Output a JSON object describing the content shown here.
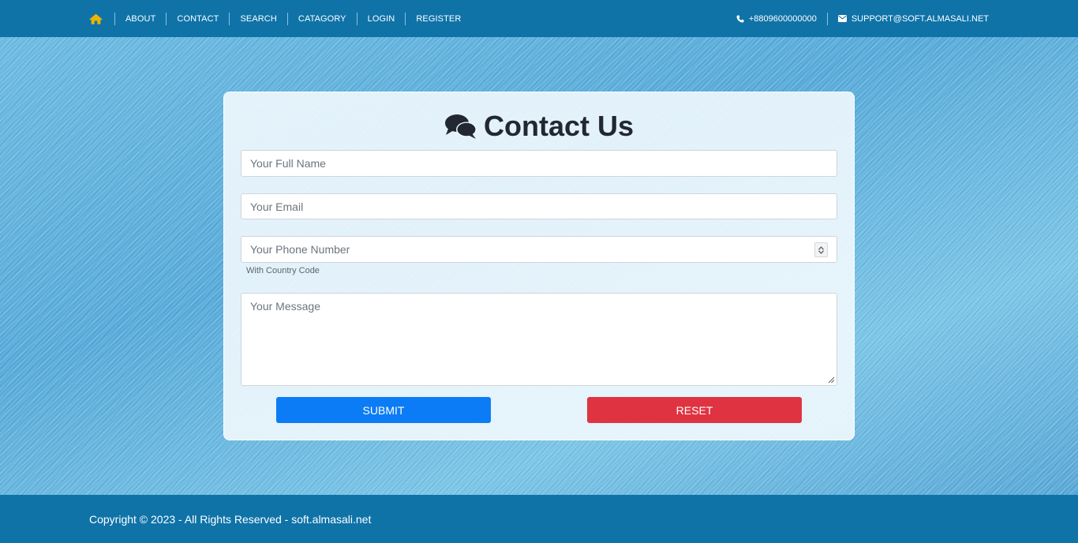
{
  "nav": {
    "home_icon": "home-icon",
    "items": [
      {
        "label": "ABOUT"
      },
      {
        "label": "CONTACT"
      },
      {
        "label": "SEARCH"
      },
      {
        "label": "CATAGORY"
      },
      {
        "label": "LOGIN"
      },
      {
        "label": "REGISTER"
      }
    ]
  },
  "contact_info": {
    "phone": "+8809600000000",
    "phone_icon": "phone-icon",
    "email": "SUPPORT@SOFT.ALMASALI.NET",
    "email_icon": "envelope-icon"
  },
  "form": {
    "title": "Contact Us",
    "title_icon": "comments-icon",
    "name_placeholder": "Your Full Name",
    "email_placeholder": "Your Email",
    "phone_placeholder": "Your Phone Number",
    "phone_hint": "With Country Code",
    "message_placeholder": "Your Message",
    "submit_label": "SUBMIT",
    "reset_label": "RESET"
  },
  "footer": {
    "copyright": "Copyright © 2023 - All Rights Reserved - soft.almasali.net"
  },
  "colors": {
    "bar": "#0f73a8",
    "home_icon": "#f0b400",
    "submit": "#0b7cf5",
    "reset": "#df3342"
  }
}
